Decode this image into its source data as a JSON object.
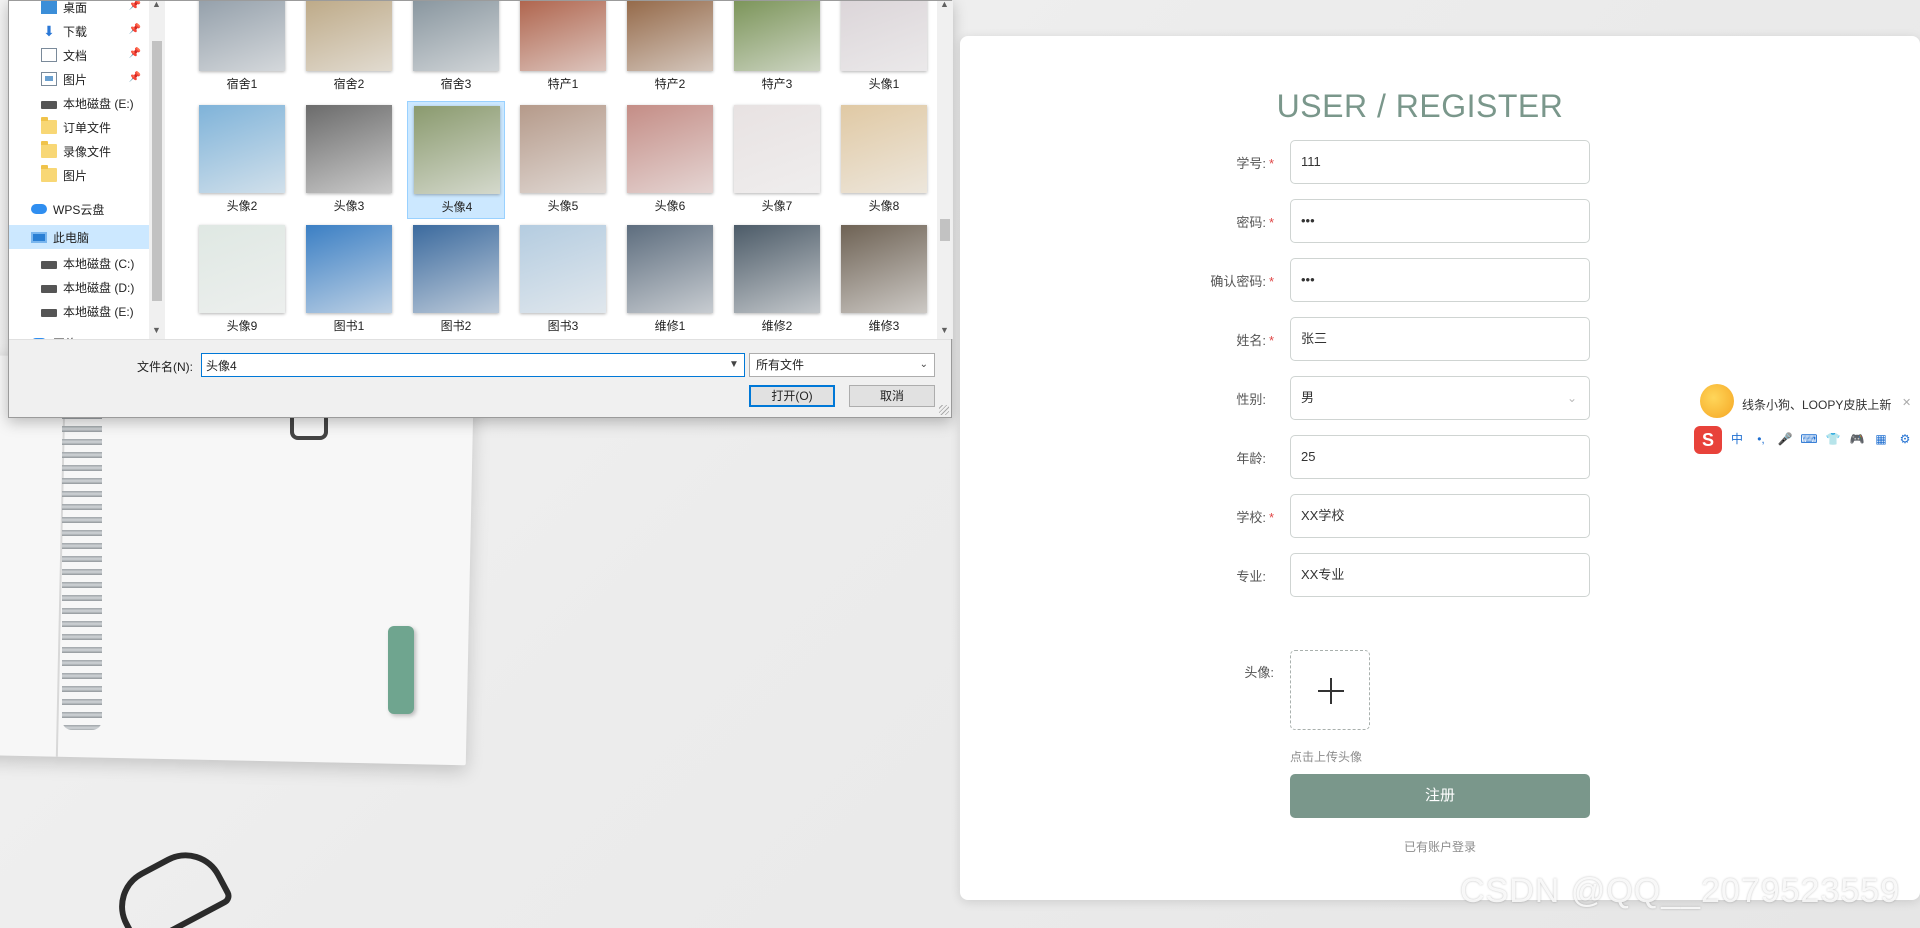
{
  "file_dialog": {
    "nav_items": [
      {
        "label": "桌面",
        "icon": "desktop-icon",
        "pinned": true
      },
      {
        "label": "下载",
        "icon": "download-icon",
        "pinned": true
      },
      {
        "label": "文档",
        "icon": "document-icon",
        "pinned": true
      },
      {
        "label": "图片",
        "icon": "picture-icon",
        "pinned": true
      },
      {
        "label": "本地磁盘 (E:)",
        "icon": "drive-icon"
      },
      {
        "label": "订单文件",
        "icon": "folder-icon"
      },
      {
        "label": "录像文件",
        "icon": "folder-icon"
      },
      {
        "label": "图片",
        "icon": "folder-icon"
      },
      {
        "label": "WPS云盘",
        "icon": "cloud-icon"
      },
      {
        "label": "此电脑",
        "icon": "computer-icon",
        "selected": true
      },
      {
        "label": "本地磁盘 (C:)",
        "icon": "drive-icon"
      },
      {
        "label": "本地磁盘 (D:)",
        "icon": "drive-icon"
      },
      {
        "label": "本地磁盘 (E:)",
        "icon": "drive-icon"
      },
      {
        "label": "网络",
        "icon": "network-icon"
      }
    ],
    "files": [
      {
        "label": "宿舍1",
        "color": "#8a97a3"
      },
      {
        "label": "宿舍2",
        "color": "#b8a27c"
      },
      {
        "label": "宿舍3",
        "color": "#7d8c96"
      },
      {
        "label": "特产1",
        "color": "#a8553b"
      },
      {
        "label": "特产2",
        "color": "#8a5a36"
      },
      {
        "label": "特产3",
        "color": "#6e8a48"
      },
      {
        "label": "头像1",
        "color": "#d9d2d6"
      },
      {
        "label": "头像2",
        "color": "#7fb3d9"
      },
      {
        "label": "头像3",
        "color": "#6b6b6b"
      },
      {
        "label": "头像4",
        "color": "#8a9a6e",
        "selected": true
      },
      {
        "label": "头像5",
        "color": "#b59a8a"
      },
      {
        "label": "头像6",
        "color": "#c48d86"
      },
      {
        "label": "头像7",
        "color": "#e8e2e2"
      },
      {
        "label": "头像8",
        "color": "#e0c9a4"
      },
      {
        "label": "头像9",
        "color": "#dfe8e3"
      },
      {
        "label": "图书1",
        "color": "#3b7fc4"
      },
      {
        "label": "图书2",
        "color": "#3b6a9e"
      },
      {
        "label": "图书3",
        "color": "#b4cce0"
      },
      {
        "label": "维修1",
        "color": "#5d6d7e"
      },
      {
        "label": "维修2",
        "color": "#4c5b68"
      },
      {
        "label": "维修3",
        "color": "#6e6254"
      }
    ],
    "filename_label": "文件名(N):",
    "filename_value": "头像4",
    "filetype_value": "所有文件",
    "open_label": "打开(O)",
    "cancel_label": "取消"
  },
  "register": {
    "title": "USER / REGISTER",
    "fields": [
      {
        "label": "学号:",
        "required": true,
        "value": "111"
      },
      {
        "label": "密码:",
        "required": true,
        "value": "•••"
      },
      {
        "label": "确认密码:",
        "required": true,
        "value": "•••"
      },
      {
        "label": "姓名:",
        "required": true,
        "value": "张三"
      },
      {
        "label": "性别:",
        "required": false,
        "value": "男",
        "type": "select"
      },
      {
        "label": "年龄:",
        "required": false,
        "value": "25"
      },
      {
        "label": "学校:",
        "required": true,
        "value": "XX学校"
      },
      {
        "label": "专业:",
        "required": false,
        "value": "XX专业"
      }
    ],
    "avatar_label": "头像:",
    "upload_hint": "点击上传头像",
    "register_label": "注册",
    "login_link": "已有账户登录",
    "accent_color": "#7a978b"
  },
  "ime": {
    "tip": "线条小狗、LOOPY皮肤上新",
    "logo": "S",
    "icons": [
      "中",
      "•,",
      "🎤",
      "⌨",
      "👕",
      "🎮",
      "▦",
      "⚙"
    ]
  },
  "watermark": "CSDN @QQ__2079523559"
}
